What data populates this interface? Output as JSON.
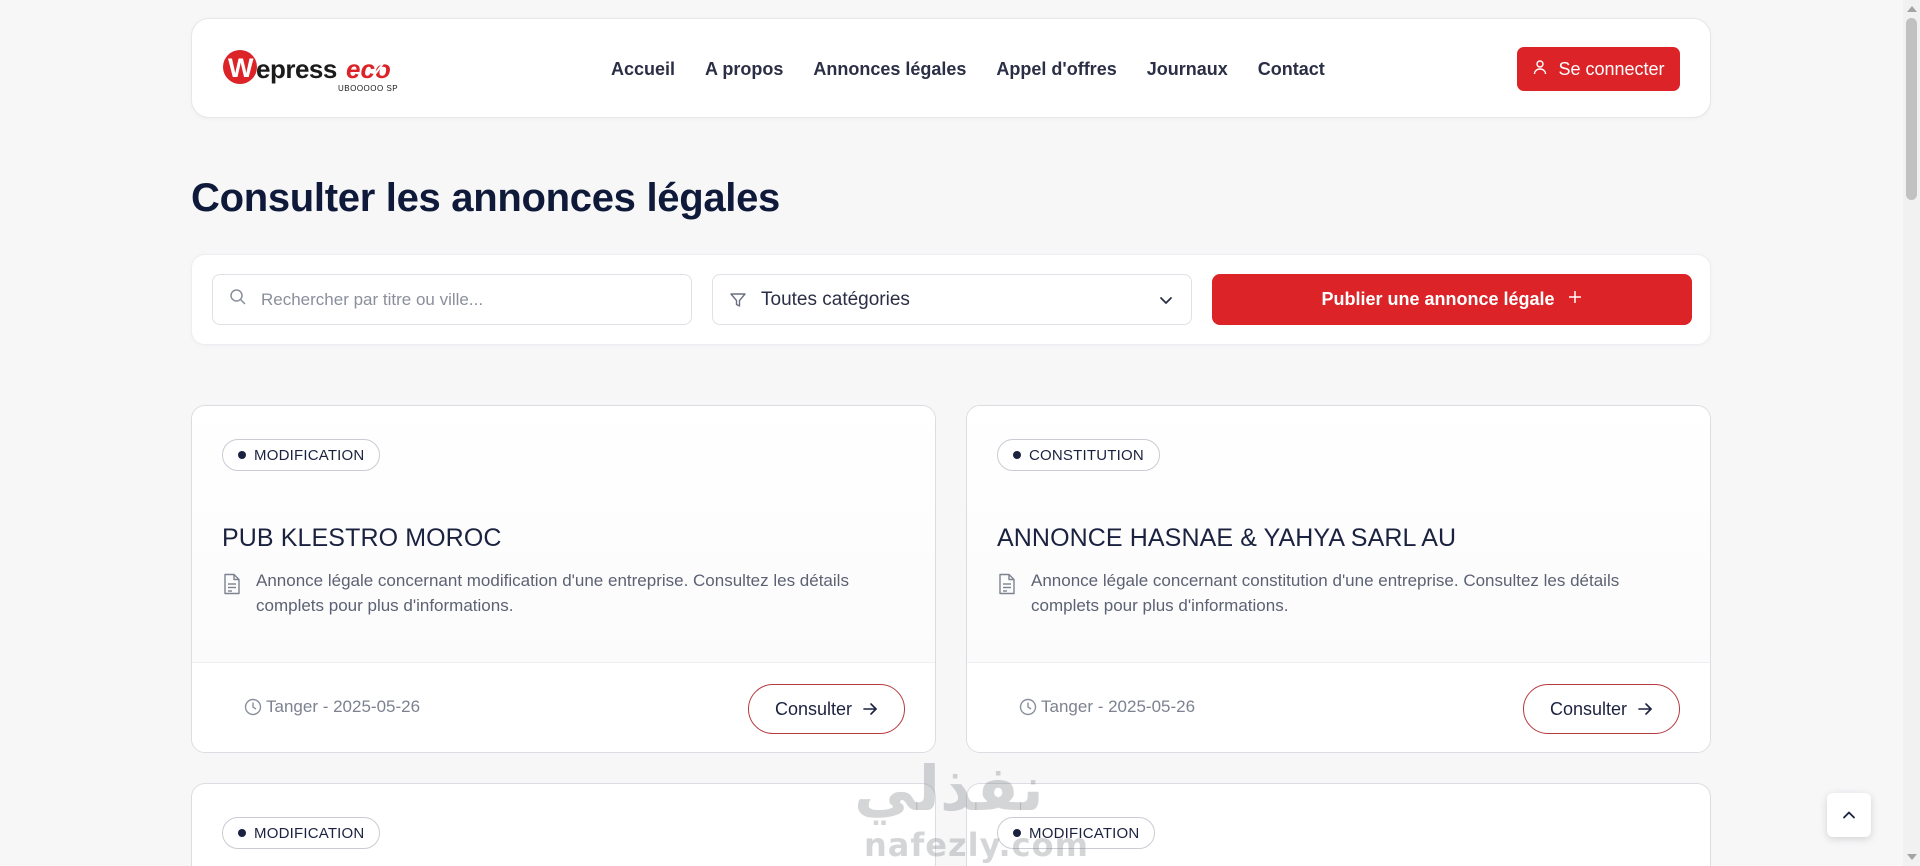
{
  "logo": {
    "text": "Wepress eco",
    "tagline": "UBOOOOO SP"
  },
  "nav": {
    "items": [
      "Accueil",
      "A propos",
      "Annonces légales",
      "Appel d'offres",
      "Journaux",
      "Contact"
    ]
  },
  "header": {
    "login_label": "Se connecter"
  },
  "page": {
    "title": "Consulter les annonces légales"
  },
  "filters": {
    "search_placeholder": "Rechercher par titre ou ville...",
    "category_selected": "Toutes catégories",
    "publish_label": "Publier une annonce légale"
  },
  "cards": [
    {
      "category": "MODIFICATION",
      "title": "PUB KLESTRO MOROC",
      "description": "Annonce légale concernant modification d'une entreprise. Consultez les détails complets pour plus d'informations.",
      "meta": "Tanger - 2025-05-26",
      "action": "Consulter"
    },
    {
      "category": "CONSTITUTION",
      "title": "ANNONCE HASNAE & YAHYA SARL AU",
      "description": "Annonce légale concernant constitution d'une entreprise. Consultez les détails complets pour plus d'informations.",
      "meta": "Tanger - 2025-05-26",
      "action": "Consulter"
    },
    {
      "category": "MODIFICATION"
    },
    {
      "category": "MODIFICATION"
    }
  ],
  "watermark": {
    "arabic": "نفذلي",
    "latin": "nafezly.com"
  },
  "colors": {
    "brand_red": "#dc2328",
    "navy": "#0f1a3a",
    "background": "#f7f7f8"
  }
}
